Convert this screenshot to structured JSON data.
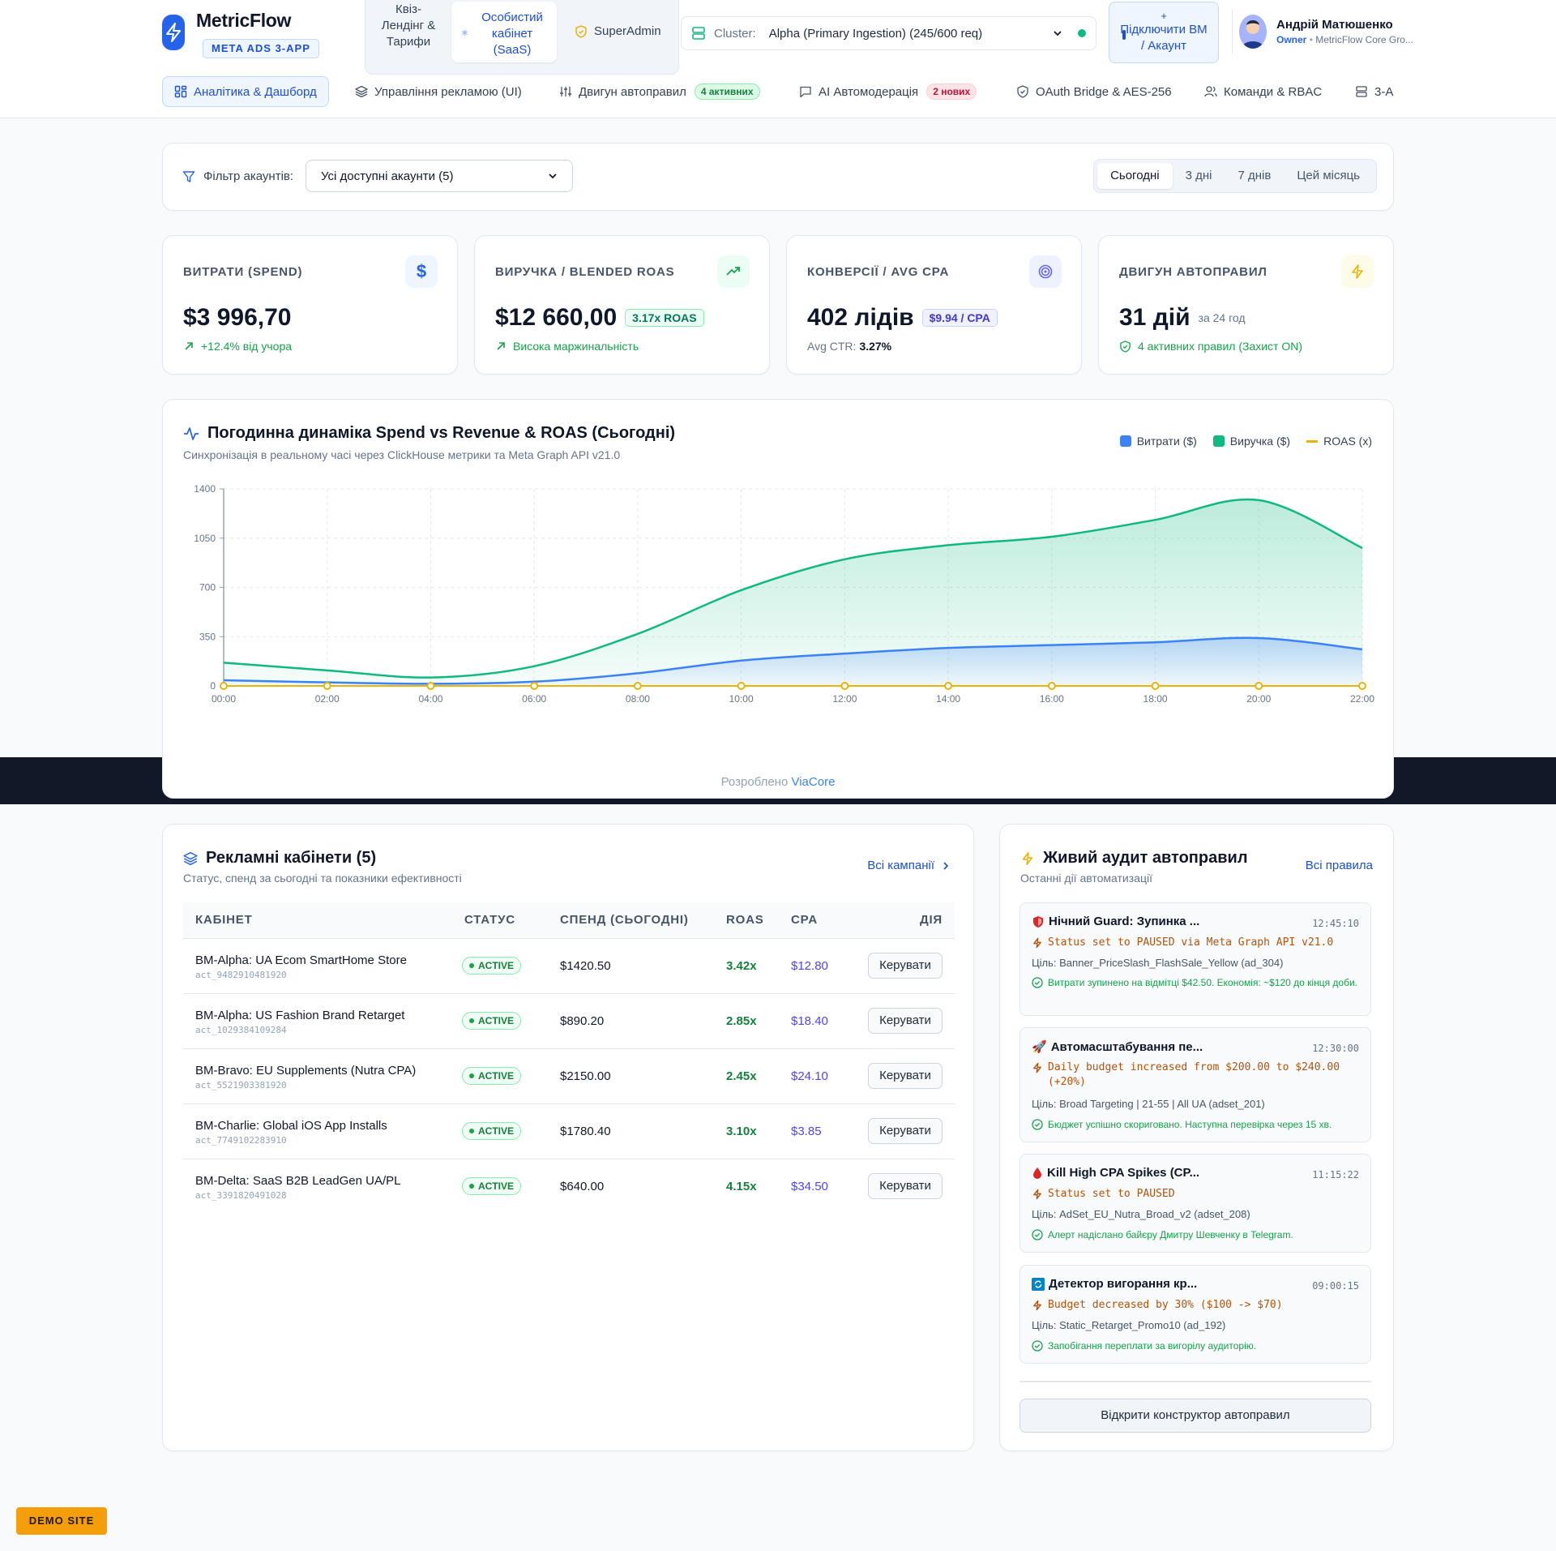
{
  "app": {
    "name": "MetricFlow",
    "badge": "META ADS 3-APP"
  },
  "segments": [
    {
      "label": "Квіз-Лендінг & Тарифи"
    },
    {
      "label": "Особистий кабінет (SaaS)"
    },
    {
      "label": "SuperAdmin"
    }
  ],
  "cluster": {
    "label": "Cluster:",
    "value": "Alpha (Primary Ingestion) (245/600 req)",
    "status_color": "#10b981"
  },
  "connect": {
    "plus": "+",
    "label": "Підключити BM / Акаунт"
  },
  "user": {
    "name": "Андрій Матюшенко",
    "role": "Owner",
    "org": "MetricFlow Core Gro..."
  },
  "nav": [
    {
      "label": "Аналітика & Дашборд"
    },
    {
      "label": "Управління рекламою (UI)"
    },
    {
      "label": "Двигун автоправил",
      "pill": "4 активних"
    },
    {
      "label": "AI Автомодерація",
      "pill": "2 нових"
    },
    {
      "label": "OAuth Bridge & AES-256"
    },
    {
      "label": "Команди & RBAC"
    },
    {
      "label": "3-A"
    }
  ],
  "filter": {
    "label": "Фільтр акаунтів:",
    "value": "Усі доступні акаунти (5)",
    "ranges": [
      "Сьогодні",
      "3 дні",
      "7 днів",
      "Цей місяць"
    ],
    "active_range": "Сьогодні"
  },
  "kpis": [
    {
      "title": "ВИТРАТИ (SPEND)",
      "value": "$3 996,70",
      "chip": "",
      "subtitle": "",
      "sub": "+12.4% від учора"
    },
    {
      "title": "ВИРУЧКА / BLENDED ROAS",
      "value": "$12 660,00",
      "chip": "3.17x ROAS",
      "subtitle": "",
      "sub": "Висока маржинальність"
    },
    {
      "title": "КОНВЕРСІЇ / AVG CPA",
      "value": "402 лідів",
      "chip": "$9.94 / CPA",
      "subtitle": "",
      "sub_label": "Avg CTR:",
      "sub_value": "3.27%"
    },
    {
      "title": "ДВИГУН АВТОПРАВИЛ",
      "value": "31 дій",
      "suffix": "за 24 год",
      "sub": "4 активних правил (Захист ON)"
    }
  ],
  "chart_data": {
    "type": "area",
    "title": "Погодинна динаміка Spend vs Revenue & ROAS (Сьогодні)",
    "subtitle": "Синхронізація в реальному часі через ClickHouse метрики та Meta Graph API v21.0",
    "x": [
      "00:00",
      "02:00",
      "04:00",
      "06:00",
      "08:00",
      "10:00",
      "12:00",
      "14:00",
      "16:00",
      "18:00",
      "20:00",
      "22:00"
    ],
    "ylim": [
      0,
      1400
    ],
    "yticks": [
      0,
      350,
      700,
      1050,
      1400
    ],
    "grid": true,
    "legend_position": "top-right",
    "series": [
      {
        "name": "Витрати ($)",
        "color": "#3b82f6",
        "values": [
          40,
          25,
          15,
          30,
          90,
          180,
          230,
          270,
          290,
          310,
          340,
          260
        ]
      },
      {
        "name": "Виручка ($)",
        "color": "#10b981",
        "values": [
          165,
          110,
          60,
          140,
          370,
          680,
          900,
          1000,
          1060,
          1180,
          1320,
          980
        ]
      },
      {
        "name": "ROAS (x)",
        "color": "#eab308",
        "values": [
          0,
          0,
          0,
          0,
          0,
          0,
          0,
          0,
          0,
          0,
          0,
          0
        ]
      }
    ]
  },
  "credit": {
    "prefix": "Розроблено",
    "brand": "ViaCore"
  },
  "accounts": {
    "title": "Рекламні кабінети (5)",
    "subtitle": "Статус, спенд за сьогодні та показники ефективності",
    "link": "Всі кампанії",
    "headers": [
      "КАБІНЕТ",
      "СТАТУС",
      "СПЕНД (СЬОГОДНІ)",
      "ROAS",
      "CPA",
      "ДІЯ"
    ],
    "rows": [
      {
        "name": "BM-Alpha: UA Ecom SmartHome Store",
        "id": "act_9482910481920",
        "status": "ACTIVE",
        "spend": "$1420.50",
        "roas": "3.42x",
        "cpa": "$12.80",
        "action": "Керувати"
      },
      {
        "name": "BM-Alpha: US Fashion Brand Retarget",
        "id": "act_1029384109284",
        "status": "ACTIVE",
        "spend": "$890.20",
        "roas": "2.85x",
        "cpa": "$18.40",
        "action": "Керувати"
      },
      {
        "name": "BM-Bravo: EU Supplements (Nutra CPA)",
        "id": "act_5521903381920",
        "status": "ACTIVE",
        "spend": "$2150.00",
        "roas": "2.45x",
        "cpa": "$24.10",
        "action": "Керувати"
      },
      {
        "name": "BM-Charlie: Global iOS App Installs",
        "id": "act_7749102283910",
        "status": "ACTIVE",
        "spend": "$1780.40",
        "roas": "3.10x",
        "cpa": "$3.85",
        "action": "Керувати"
      },
      {
        "name": "BM-Delta: SaaS B2B LeadGen UA/PL",
        "id": "act_3391820491028",
        "status": "ACTIVE",
        "spend": "$640.00",
        "roas": "4.15x",
        "cpa": "$34.50",
        "action": "Керувати"
      }
    ]
  },
  "audit": {
    "title": "Живий аудит автоправил",
    "subtitle": "Останні дії автоматизації",
    "link": "Всі правила",
    "items": [
      {
        "icon": "shield-icon",
        "title": "Нічний Guard: Зупинка ...",
        "time": "12:45:10",
        "action": "Status set to PAUSED via Meta Graph API v21.0",
        "target": "Ціль: Banner_PriceSlash_FlashSale_Yellow (ad_304)",
        "result": "Витрати зупинено на відмітці $42.50. Економія: ~$120 до кінця доби."
      },
      {
        "icon": "rocket-icon",
        "title": "Автомасштабування пе...",
        "time": "12:30:00",
        "action": "Daily budget increased from $200.00 to $240.00 (+20%)",
        "target": "Ціль: Broad Targeting | 21-55 | All UA (adset_201)",
        "result": "Бюджет успішно скориговано. Наступна перевірка через 15 хв."
      },
      {
        "icon": "drop-icon",
        "title": "Kill High CPA Spikes (CP...",
        "time": "11:15:22",
        "action": "Status set to PAUSED",
        "target": "Ціль: AdSet_EU_Nutra_Broad_v2 (adset_208)",
        "result": "Алерт надіслано байєру Дмитру Шевченку в Telegram."
      },
      {
        "icon": "refresh-icon",
        "title": "Детектор вигорання кр...",
        "time": "09:00:15",
        "action": "Budget decreased by 30% ($100 -> $70)",
        "target": "Ціль: Static_Retarget_Promo10 (ad_192)",
        "result": "Запобігання переплати за вигорілу аудиторію."
      }
    ],
    "button": "Відкрити конструктор автоправил"
  },
  "demo_badge": "DEMO SITE"
}
